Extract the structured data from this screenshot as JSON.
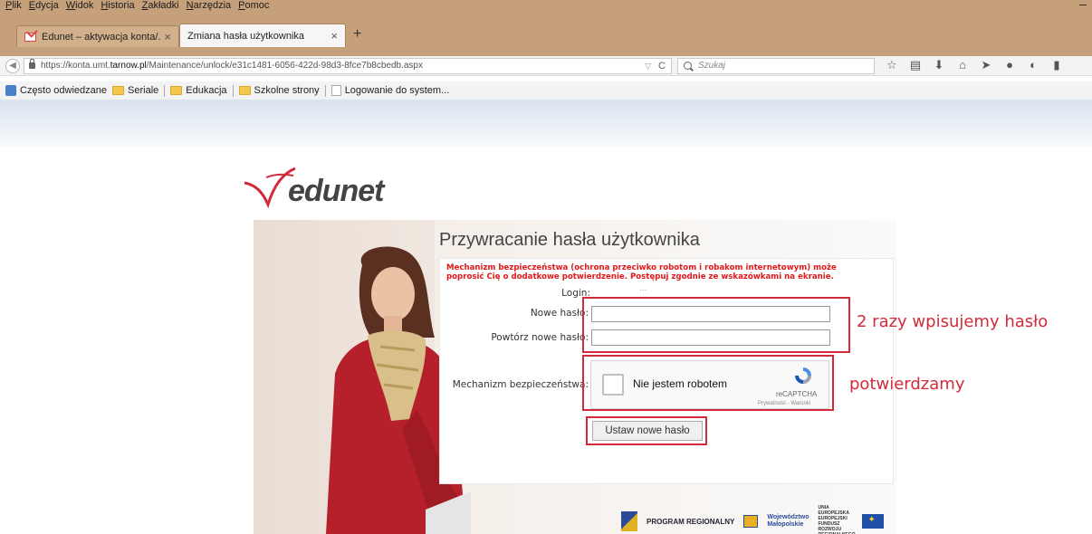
{
  "browser": {
    "menu": [
      "Plik",
      "Edycja",
      "Widok",
      "Historia",
      "Zakładki",
      "Narzędzia",
      "Pomoc"
    ],
    "minimize_glyph": "–",
    "tabs": [
      {
        "label": "Edunet – aktywacja konta/...",
        "icon": "gmail-icon",
        "close": "×"
      },
      {
        "label": "Zmiana hasła użytkownika",
        "close": "×"
      }
    ],
    "newtab_glyph": "+",
    "url_prefix": "https://konta.umt.",
    "url_domain": "tarnow.pl",
    "url_path": "/Maintenance/unlock/e31c1481-6056-422d-98d3-8fce7b8cbedb.aspx",
    "reload_glyph": "C",
    "search_placeholder": "Szukaj",
    "toolbar_icons": [
      "star-icon",
      "reading-list-icon",
      "download-icon",
      "home-icon",
      "send-icon",
      "chat-icon",
      "extension-icon",
      "menu-icon"
    ],
    "bookmarks": [
      {
        "label": "Często odwiedzane",
        "icon": "bookmark-star-icon"
      },
      {
        "label": "Seriale",
        "icon": "folder-icon"
      },
      {
        "label": "Edukacja",
        "icon": "folder-icon"
      },
      {
        "label": "Szkolne strony",
        "icon": "folder-icon"
      },
      {
        "label": "Logowanie do system...",
        "icon": "page-icon"
      }
    ]
  },
  "page": {
    "logo_text": "edunet",
    "title": "Przywracanie hasła użytkownika",
    "warning": "Mechanizm bezpieczeństwa (ochrona przeciwko robotom i robakom internetowym) może poprosić Cię o dodatkowe potwierdzenie. Postępuj zgodnie ze wskazówkami na ekranie.",
    "login_label": "Login:",
    "login_value": "...",
    "new_password_label": "Nowe hasło:",
    "repeat_password_label": "Powtórz nowe hasło:",
    "security_label": "Mechanizm bezpieczeństwa:",
    "captcha_label": "Nie jestem robotem",
    "captcha_brand": "reCAPTCHA",
    "captcha_links": "Prywatność - Warunki",
    "submit_label": "Ustaw nowe hasło",
    "note_password": "2 razy wpisujemy hasło",
    "note_confirm": "potwierdzamy",
    "highlight_color": "#d22a3a",
    "warning_color": "#e01818",
    "footer": {
      "program": "PROGRAM REGIONALNY",
      "region_line1": "Województwo",
      "region_line2": "Małopolskie",
      "eu_text": "UNIA EUROPEJSKA EUROPEJSKI FUNDUSZ ROZWOJU REGIONALNEGO"
    }
  }
}
